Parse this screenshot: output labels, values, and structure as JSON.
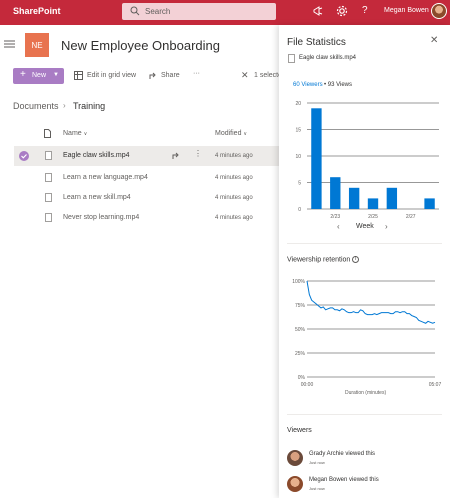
{
  "app": {
    "brand": "SharePoint",
    "search_placeholder": "Search",
    "user_name": "Megan Bowen",
    "accent": "#c4293b"
  },
  "site": {
    "tile": "NE",
    "title": "New Employee Onboarding"
  },
  "commands": {
    "new": "New",
    "grid": "Edit in grid view",
    "share": "Share",
    "more": "···",
    "selected": "1 selecte"
  },
  "breadcrumb": {
    "root": "Documents",
    "current": "Training"
  },
  "columns": {
    "name": "Name",
    "modified": "Modified"
  },
  "files": [
    {
      "name": "Eagle claw skills.mp4",
      "modified": "4 minutes ago"
    },
    {
      "name": "Learn a new language.mp4",
      "modified": "4 minutes ago"
    },
    {
      "name": "Learn a new skill.mp4",
      "modified": "4 minutes ago"
    },
    {
      "name": "Never stop learning.mp4",
      "modified": "4 minutes ago"
    }
  ],
  "panel": {
    "title": "File Statistics",
    "file_name": "Eagle claw skills.mp4",
    "viewers_count": "60 Viewers",
    "views_count": "• 93 Views",
    "week_label": "Week",
    "retention_title": "Viewership retention",
    "retention_xlabel": "Duration (minutes)",
    "viewers_title": "Viewers",
    "viewers": [
      {
        "name": "Grady Archie viewed this",
        "time": "Just now"
      },
      {
        "name": "Megan Bowen viewed this",
        "time": "Just now"
      }
    ]
  },
  "chart_data": [
    {
      "type": "bar",
      "title": "",
      "x": [
        "2/21",
        "2/22",
        "2/23",
        "2/24",
        "2/25",
        "2/26",
        "2/27",
        "2/28"
      ],
      "x_tick_labels": [
        "2/23",
        "2/25",
        "2/27"
      ],
      "values": [
        19,
        6,
        4,
        2,
        4,
        0,
        2
      ],
      "ylim": [
        0,
        20
      ],
      "y_ticks": [
        "0",
        "5",
        "10",
        "15",
        "20"
      ],
      "xlabel": "Week",
      "grid": true,
      "bar_color": "#0078d4"
    },
    {
      "type": "line",
      "title": "Viewership retention",
      "x_tick_labels": [
        "00:00",
        "05:07"
      ],
      "y_ticks": [
        "0%",
        "25%",
        "50%",
        "75%",
        "100%"
      ],
      "ylim": [
        0,
        100
      ],
      "xlabel": "Duration (minutes)",
      "values": [
        100,
        86,
        80,
        78,
        76,
        74,
        72,
        73,
        70,
        71,
        72,
        72,
        70,
        70,
        69,
        71,
        70,
        68,
        67,
        67,
        68,
        67,
        67,
        70,
        69,
        66,
        65,
        65,
        65,
        66,
        65,
        66,
        67,
        67,
        67,
        67,
        66,
        66,
        68,
        68,
        67,
        68,
        68,
        66,
        66,
        64,
        63,
        62,
        59,
        58,
        57,
        56,
        58,
        57,
        56,
        57
      ],
      "grid": true,
      "line_color": "#0078d4"
    }
  ]
}
